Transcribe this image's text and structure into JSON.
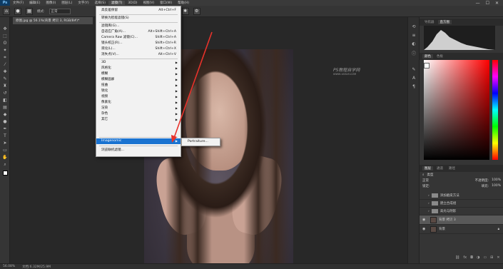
{
  "menubar": {
    "logo": "Ps",
    "items": [
      "文件(F)",
      "编辑(E)",
      "图像(I)",
      "图层(L)",
      "文字(Y)",
      "选择(S)",
      "滤镜(T)",
      "3D(D)",
      "视图(V)",
      "窗口(W)",
      "帮助(H)"
    ],
    "active_index": 6,
    "window_controls": [
      "—",
      "☐",
      "✕"
    ]
  },
  "options": {
    "mode_label": "模式:",
    "mode_value": "正常"
  },
  "document_tab": {
    "title": "原图.jpg @ 56.1%(背景 拷贝 3, RGB/8#)*"
  },
  "filter_menu": {
    "items": [
      {
        "label": "高反差保留",
        "shortcut": "Alt+Ctrl+F"
      },
      {
        "label": "转换为智能滤镜(S)",
        "shortcut": ""
      },
      {
        "label": "滤镜库(G)...",
        "shortcut": ""
      },
      {
        "label": "自适应广角(A)...",
        "shortcut": "Alt+Shift+Ctrl+A"
      },
      {
        "label": "Camera Raw 滤镜(C)...",
        "shortcut": "Shift+Ctrl+A"
      },
      {
        "label": "镜头校正(R)...",
        "shortcut": "Shift+Ctrl+R"
      },
      {
        "label": "液化(L)...",
        "shortcut": "Shift+Ctrl+X"
      },
      {
        "label": "消失点(V)...",
        "shortcut": "Alt+Ctrl+V"
      },
      {
        "label": "3D",
        "shortcut": ""
      },
      {
        "label": "风格化",
        "shortcut": ""
      },
      {
        "label": "模糊",
        "shortcut": ""
      },
      {
        "label": "模糊画廊",
        "shortcut": ""
      },
      {
        "label": "扭曲",
        "shortcut": ""
      },
      {
        "label": "锐化",
        "shortcut": ""
      },
      {
        "label": "视频",
        "shortcut": ""
      },
      {
        "label": "像素化",
        "shortcut": ""
      },
      {
        "label": "渲染",
        "shortcut": ""
      },
      {
        "label": "杂色",
        "shortcut": ""
      },
      {
        "label": "其它",
        "shortcut": ""
      },
      {
        "label": "Imagenomic",
        "shortcut": ""
      },
      {
        "label": "浏览联机滤镜...",
        "shortcut": ""
      }
    ]
  },
  "submenu": {
    "item": "Portraiture..."
  },
  "watermark": {
    "title": "PS教程自学网",
    "url": "WWW.16XX8.COM"
  },
  "panels": {
    "top_tabs": [
      "导航器",
      "直方图"
    ],
    "color_tabs": [
      "颜色",
      "色板"
    ],
    "layer_tabs": [
      "图层",
      "通道",
      "路径"
    ],
    "layer_kind": "类型",
    "blend_mode": "正常",
    "opacity_label": "不透明度:",
    "opacity_value": "100%",
    "fill_label": "填充:",
    "fill_value": "100%",
    "lock_label": "锁定:",
    "layers": [
      {
        "name": "添加磨皮方法",
        "type": "group",
        "selected": false
      },
      {
        "name": "建立合成组",
        "type": "group",
        "selected": false
      },
      {
        "name": "高光与阴影",
        "type": "group",
        "selected": false
      },
      {
        "name": "背景 拷贝 3",
        "type": "layer",
        "selected": true
      },
      {
        "name": "背景",
        "type": "layer",
        "selected": false
      }
    ]
  },
  "statusbar": {
    "zoom": "56.08%",
    "doc_info": "文档:6.32M/25.9M"
  },
  "colors": {
    "highlight": "#1a73d1",
    "arrow": "#e8322b"
  }
}
